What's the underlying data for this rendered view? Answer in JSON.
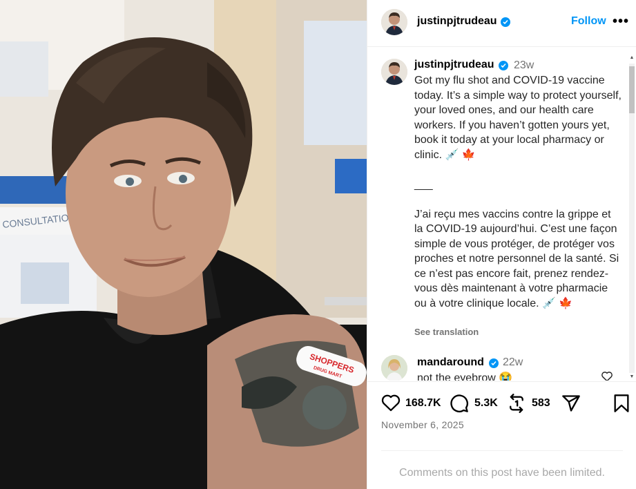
{
  "post": {
    "username": "justinpjtrudeau",
    "follow_label": "Follow",
    "more_label": "•••",
    "caption_time": "23w",
    "caption": "Got my flu shot and COVID-19 vaccine today. It’s a simple way to protect yourself, your loved ones, and our health care workers. If you haven’t gotten yours yet, book it today at your local pharmacy or clinic. 💉 🍁\n\n___\n\nJ’ai reçu mes vaccins contre la grippe et la COVID-19 aujourd’hui. C’est une façon simple de vous protéger, de protéger vos proches et notre personnel de la santé. Si ce n’est pas encore fait, prenez rendez-vous dès maintenant à votre pharmacie ou à votre clinique locale. 💉 🍁",
    "see_translation": "See translation",
    "likes": "168.7K",
    "comments_count": "5.3K",
    "reposts": "583",
    "date": "November 6, 2025",
    "comments_limited": "Comments on this post have been limited."
  },
  "comment": {
    "username": "mandaround",
    "time": "22w",
    "text": "not the eyebrow 😭"
  },
  "photo": {
    "sticker_text": "SHOPPERS",
    "sticker_subtext": "DRUG MART",
    "sign_text": "CONSULTATION"
  },
  "colors": {
    "accent": "#0095f6",
    "muted": "#737373",
    "limited": "#a8a8a8"
  },
  "icons": [
    "verified-icon",
    "more-icon",
    "heart-icon",
    "comment-icon",
    "repost-icon",
    "share-icon",
    "save-icon"
  ]
}
